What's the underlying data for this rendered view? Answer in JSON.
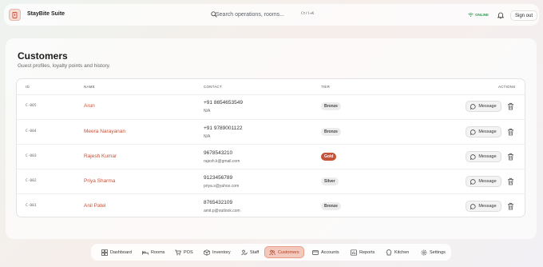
{
  "header": {
    "app_title": "StayBite Suite",
    "search_placeholder": "Search operations, rooms...",
    "search_shortcut": "Ctrl+K",
    "status": "ONLINE",
    "sign_out": "Sign out"
  },
  "page": {
    "title": "Customers",
    "subtitle": "Guest profiles, loyalty points and history."
  },
  "table": {
    "columns": {
      "id": "ID",
      "name": "NAME",
      "contact": "CONTACT",
      "tier": "TIER",
      "actions": "ACTIONS"
    },
    "message_label": "Message",
    "rows": [
      {
        "id": "C-005",
        "name": "Arun",
        "phone": "+91 8654653549",
        "email": "N/A",
        "tier": "Bronze"
      },
      {
        "id": "C-004",
        "name": "Meera Narayanan",
        "phone": "+91 9789001122",
        "email": "N/A",
        "tier": "Bronze"
      },
      {
        "id": "C-003",
        "name": "Rajesh Kumar",
        "phone": "9678543210",
        "email": "rajesh.k@gmail.com",
        "tier": "Gold"
      },
      {
        "id": "C-002",
        "name": "Priya Sharma",
        "phone": "9123456789",
        "email": "priya.s@yahoo.com",
        "tier": "Silver"
      },
      {
        "id": "C-001",
        "name": "Anil Patel",
        "phone": "8765432109",
        "email": "amit.p@outlook.com",
        "tier": "Bronze"
      }
    ]
  },
  "nav": {
    "items": [
      {
        "label": "Dashboard",
        "icon": "grid-icon"
      },
      {
        "label": "Rooms",
        "icon": "bed-icon"
      },
      {
        "label": "POS",
        "icon": "cart-icon"
      },
      {
        "label": "Inventory",
        "icon": "box-icon"
      },
      {
        "label": "Staff",
        "icon": "staff-icon"
      },
      {
        "label": "Customers",
        "icon": "users-icon"
      },
      {
        "label": "Accounts",
        "icon": "wallet-icon"
      },
      {
        "label": "Reports",
        "icon": "chart-icon"
      },
      {
        "label": "Kitchen",
        "icon": "chef-icon"
      },
      {
        "label": "Settings",
        "icon": "gear-icon"
      }
    ],
    "active": "Customers"
  },
  "colors": {
    "accent": "#c4533a",
    "online": "#2f9a55",
    "gold_badge": "#c4533a"
  }
}
